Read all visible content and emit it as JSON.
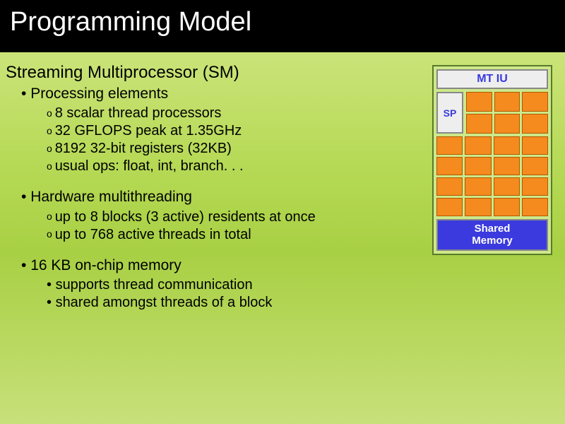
{
  "title": "Programming Model",
  "heading": "Streaming Multiprocessor (SM)",
  "section1": {
    "title": "Processing elements",
    "items": [
      "8 scalar thread processors",
      "32 GFLOPS peak at 1.35GHz",
      "8192 32-bit registers (32KB)",
      "usual ops: float, int, branch. . ."
    ]
  },
  "section2": {
    "title": "Hardware multithreading",
    "items": [
      "up to 8 blocks (3 active) residents at once",
      "up to 768 active threads in total"
    ]
  },
  "section3": {
    "title": "16 KB on-chip memory",
    "items": [
      "supports thread communication",
      "shared amongst threads of a block"
    ]
  },
  "diagram": {
    "mt_iu": "MT IU",
    "sp": "SP",
    "shared1": "Shared",
    "shared2": "Memory"
  }
}
